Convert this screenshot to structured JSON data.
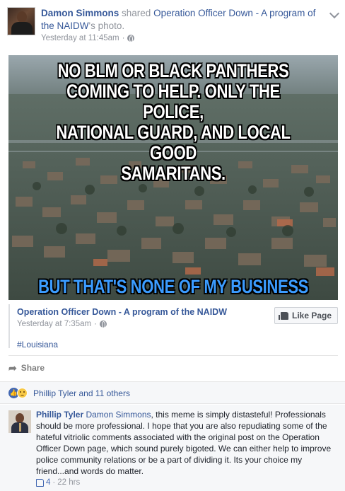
{
  "post": {
    "author": "Damon Simmons",
    "shared_word": " shared ",
    "page": "Operation Officer Down - A program of the NAIDW",
    "possessive": "'s photo.",
    "time": "Yesterday at 11:45am",
    "separator": "·"
  },
  "meme": {
    "top_lines": [
      "NO BLM OR BLACK PANTHERS",
      "COMING TO HELP. ONLY THE POLICE,",
      "NATIONAL GUARD, AND LOCAL GOOD",
      "SAMARITANS."
    ],
    "bottom_text": "BUT THAT'S NONE OF MY BUSINESS"
  },
  "shared": {
    "page": "Operation Officer Down - A program of the NAIDW",
    "time": "Yesterday at 7:35am",
    "separator": "·",
    "like_button": "Like Page",
    "hashtag": "#Louisiana"
  },
  "actions": {
    "share": "Share"
  },
  "reactions": {
    "text": "Phillip Tyler and 11 others"
  },
  "comment": {
    "author": "Phillip Tyler",
    "mention": "Damon Simmons",
    "text": ", this meme is simply distasteful! Professionals should be more professional. I hope that you are also repudiating some of the hateful vitriolic comments associated with the original post on the Operation Officer Down page, which sound purely bigoted. We can either help to improve police community relations or be a part of dividing it. Its your choice my friend...and words do matter.",
    "likes": "4",
    "separator": "·",
    "time": "22 hrs"
  },
  "colors": {
    "link": "#365899",
    "meta": "#90949c",
    "meme_bottom": "#3b9cff"
  }
}
